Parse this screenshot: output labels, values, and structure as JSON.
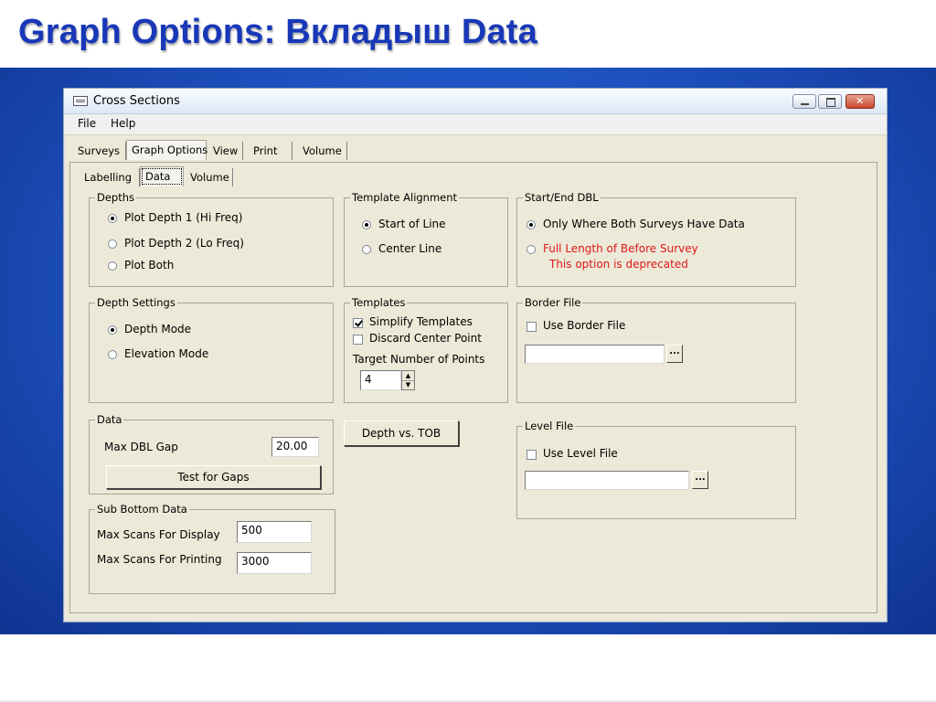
{
  "slide": {
    "title": "Graph Options: Вкладыш Data"
  },
  "window": {
    "title": "Cross  Sections",
    "controls": {
      "minimize": "minimize",
      "maximize": "maximize",
      "close": "close"
    }
  },
  "menu": {
    "file": "File",
    "help": "Help"
  },
  "main_tabs": {
    "surveys": "Surveys",
    "graph_options": "Graph Options",
    "view": "View",
    "print": "Print",
    "volume": "Volume"
  },
  "sub_tabs": {
    "labelling": "Labelling",
    "data": "Data",
    "volume": "Volume"
  },
  "depths": {
    "label": "Depths",
    "opt1": "Plot Depth 1 (Hi Freq)",
    "opt2": "Plot Depth 2 (Lo Freq)",
    "opt3": "Plot Both",
    "selected": "opt1"
  },
  "template_alignment": {
    "label": "Template Alignment",
    "opt1": "Start of Line",
    "opt2": "Center Line",
    "selected": "opt1"
  },
  "start_end_dbl": {
    "label": "Start/End DBL",
    "opt1": "Only Where Both Surveys Have Data",
    "opt2": "Full Length of Before Survey",
    "note": "This option is deprecated",
    "selected": "opt1"
  },
  "depth_settings": {
    "label": "Depth Settings",
    "opt1": "Depth Mode",
    "opt2": "Elevation Mode",
    "selected": "opt1"
  },
  "templates": {
    "label": "Templates",
    "simplify": "Simplify Templates",
    "simplify_checked": true,
    "discard": "Discard Center Point",
    "discard_checked": false,
    "target_label": "Target Number of Points",
    "target_value": "4"
  },
  "border_file": {
    "label": "Border File",
    "use_label": "Use Border File",
    "checked": false,
    "path": "",
    "browse": "..."
  },
  "data_group": {
    "label": "Data",
    "max_dbl_gap_label": "Max DBL Gap",
    "max_dbl_gap_value": "20.00",
    "test_button": "Test for Gaps"
  },
  "depth_vs_tob_button": "Depth vs. TOB",
  "level_file": {
    "label": "Level File",
    "use_label": "Use Level File",
    "checked": false,
    "path": "",
    "browse": "..."
  },
  "sub_bottom": {
    "label": "Sub Bottom Data",
    "display_label": "Max Scans For Display",
    "display_value": "500",
    "printing_label": "Max Scans For Printing",
    "printing_value": "3000"
  },
  "colors": {
    "title_blue": "#1838b8",
    "background_blue": "#1f55c4",
    "deprecated_red": "#e01818",
    "window_face": "#ece9d8"
  }
}
